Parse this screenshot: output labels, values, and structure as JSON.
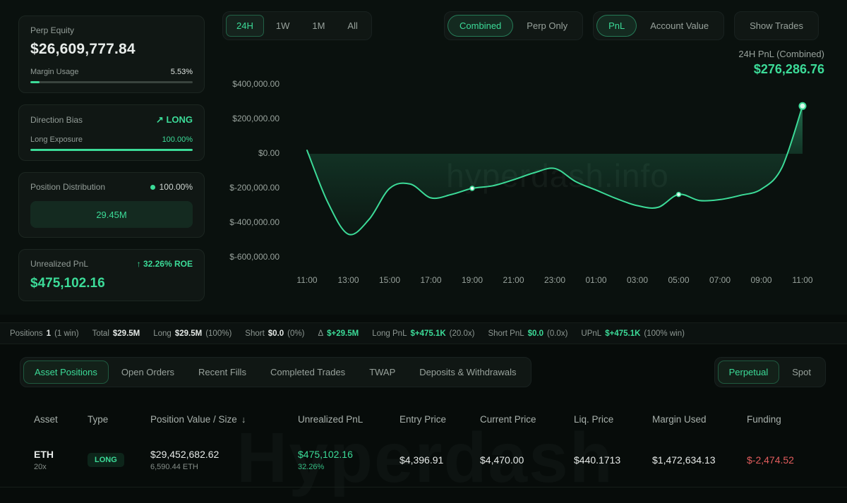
{
  "colors": {
    "green": "#3cdb98",
    "red": "#e25d5d"
  },
  "sidebar": {
    "perp_equity": {
      "label": "Perp Equity",
      "value": "$26,609,777.84",
      "margin_usage_label": "Margin Usage",
      "margin_usage_value": "5.53%",
      "margin_usage_pct": 5.53
    },
    "direction_bias": {
      "label": "Direction Bias",
      "icon": "↗",
      "value": "LONG",
      "exposure_label": "Long Exposure",
      "exposure_value": "100.00%",
      "exposure_pct": 100
    },
    "position_distribution": {
      "label": "Position Distribution",
      "pct": "100.00%",
      "bar_label": "29.45M"
    },
    "unrealized_pnl": {
      "label": "Unrealized PnL",
      "roe_icon": "↑",
      "roe": "32.26% ROE",
      "value": "$475,102.16"
    }
  },
  "controls": {
    "time_ranges": [
      {
        "label": "24H",
        "active": true
      },
      {
        "label": "1W",
        "active": false
      },
      {
        "label": "1M",
        "active": false
      },
      {
        "label": "All",
        "active": false
      }
    ],
    "mode_toggle": [
      {
        "label": "Combined",
        "active": true
      },
      {
        "label": "Perp Only",
        "active": false
      }
    ],
    "metric_toggle": [
      {
        "label": "PnL",
        "active": true
      },
      {
        "label": "Account Value",
        "active": false
      }
    ],
    "show_trades_label": "Show Trades"
  },
  "chart_data": {
    "type": "area",
    "title": "24H PnL (Combined)",
    "value_label": "$276,286.76",
    "line_color": "#3cdb98",
    "grid": false,
    "legend_position": "none",
    "ylim": [
      -600000,
      400000
    ],
    "yticks": [
      {
        "v": 400000,
        "label": "$400,000.00"
      },
      {
        "v": 200000,
        "label": "$200,000.00"
      },
      {
        "v": 0,
        "label": "$0.00"
      },
      {
        "v": -200000,
        "label": "$-200,000.00"
      },
      {
        "v": -400000,
        "label": "$-400,000.00"
      },
      {
        "v": -600000,
        "label": "$-600,000.00"
      }
    ],
    "x": [
      "11:00",
      "12:00",
      "13:00",
      "14:00",
      "15:00",
      "16:00",
      "17:00",
      "18:00",
      "19:00",
      "20:00",
      "21:00",
      "22:00",
      "23:00",
      "00:00",
      "01:00",
      "02:00",
      "03:00",
      "04:00",
      "05:00",
      "06:00",
      "07:00",
      "08:00",
      "09:00",
      "10:00",
      "11:00"
    ],
    "xtick_every": 2,
    "values": [
      20000,
      -280000,
      -465000,
      -380000,
      -200000,
      -175000,
      -255000,
      -235000,
      -200000,
      -185000,
      -150000,
      -110000,
      -85000,
      -160000,
      -210000,
      -260000,
      -300000,
      -310000,
      -235000,
      -270000,
      -265000,
      -240000,
      -205000,
      -80000,
      276286.76
    ],
    "marker_indices": [
      8,
      18,
      24
    ]
  },
  "stats": [
    {
      "label": "Positions",
      "value": "1",
      "extra": "(1 win)"
    },
    {
      "label": "Total",
      "value": "$29.5M"
    },
    {
      "label": "Long",
      "value": "$29.5M",
      "extra": "(100%)"
    },
    {
      "label": "Short",
      "value": "$0.0",
      "extra": "(0%)"
    },
    {
      "label": "Δ",
      "value": "$+29.5M",
      "vc": "green"
    },
    {
      "label": "Long PnL",
      "value": "$+475.1K",
      "extra": "(20.0x)",
      "vc": "green"
    },
    {
      "label": "Short PnL",
      "value": "$0.0",
      "extra": "(0.0x)",
      "vc": "green"
    },
    {
      "label": "UPnL",
      "value": "$+475.1K",
      "extra": "(100% win)",
      "vc": "green"
    }
  ],
  "tabs": {
    "left": [
      {
        "label": "Asset Positions",
        "active": true
      },
      {
        "label": "Open Orders",
        "active": false
      },
      {
        "label": "Recent Fills",
        "active": false
      },
      {
        "label": "Completed Trades",
        "active": false
      },
      {
        "label": "TWAP",
        "active": false
      },
      {
        "label": "Deposits & Withdrawals",
        "active": false
      }
    ],
    "right": [
      {
        "label": "Perpetual",
        "active": true
      },
      {
        "label": "Spot",
        "active": false
      }
    ]
  },
  "table": {
    "sort_icon": "↓",
    "columns": [
      {
        "label": "Asset"
      },
      {
        "label": "Type"
      },
      {
        "label": "Position Value / Size",
        "sort": "desc"
      },
      {
        "label": "Unrealized PnL"
      },
      {
        "label": "Entry Price"
      },
      {
        "label": "Current Price"
      },
      {
        "label": "Liq. Price"
      },
      {
        "label": "Margin Used"
      },
      {
        "label": "Funding"
      }
    ],
    "rows": [
      {
        "cells": [
          {
            "main": "ETH",
            "sub": "20x",
            "bold": true
          },
          {
            "badge": "LONG"
          },
          {
            "main": "$29,452,682.62",
            "sub": "6,590.44 ETH"
          },
          {
            "main": "$475,102.16",
            "sub": "32.26%",
            "color": "green",
            "sub_color": "green"
          },
          {
            "main": "$4,396.91"
          },
          {
            "main": "$4,470.00"
          },
          {
            "main": "$440.1713"
          },
          {
            "main": "$1,472,634.13"
          },
          {
            "main": "$-2,474.52",
            "color": "red"
          }
        ]
      }
    ]
  },
  "watermarks": {
    "chart": "hyperdash.info",
    "table": "Hyperdash"
  }
}
